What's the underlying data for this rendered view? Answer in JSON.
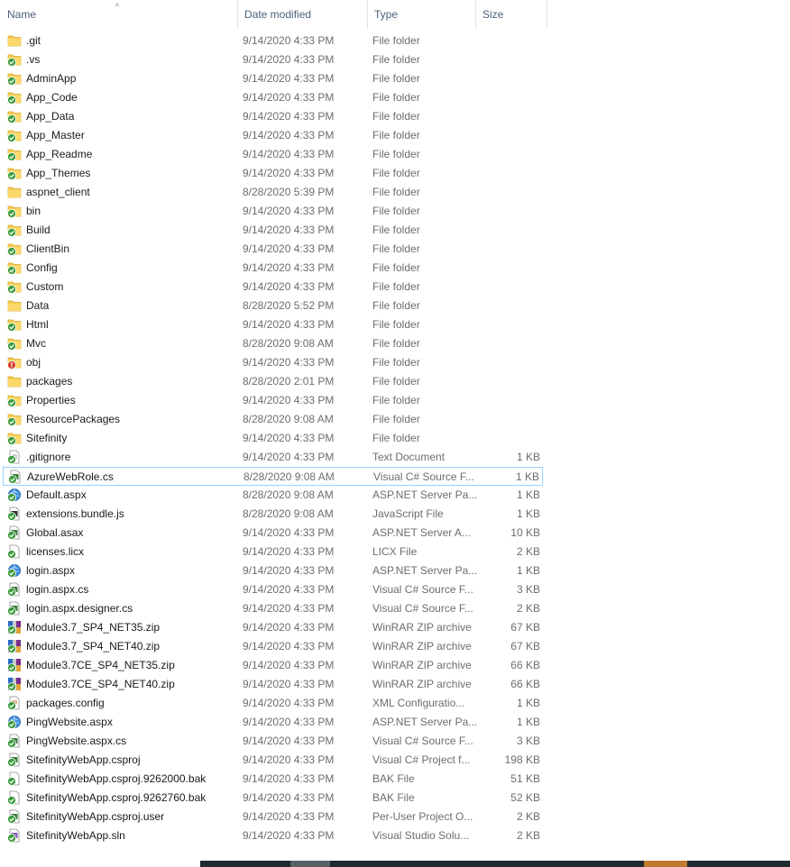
{
  "columns": {
    "name": "Name",
    "date": "Date modified",
    "type": "Type",
    "size": "Size"
  },
  "sort_arrow": "^",
  "colors": {
    "folder": "#f4c84f",
    "sync_ok": "#3a9a3a",
    "sync_error": "#d63b2e",
    "focus_border": "#99d1ff",
    "header_text": "#4c607a"
  },
  "rows": [
    {
      "name": ".git",
      "date": "9/14/2020 4:33 PM",
      "type": "File folder",
      "size": "",
      "icon": "folder",
      "badge": "none"
    },
    {
      "name": ".vs",
      "date": "9/14/2020 4:33 PM",
      "type": "File folder",
      "size": "",
      "icon": "folder",
      "badge": "ok"
    },
    {
      "name": "AdminApp",
      "date": "9/14/2020 4:33 PM",
      "type": "File folder",
      "size": "",
      "icon": "folder",
      "badge": "ok"
    },
    {
      "name": "App_Code",
      "date": "9/14/2020 4:33 PM",
      "type": "File folder",
      "size": "",
      "icon": "folder",
      "badge": "ok"
    },
    {
      "name": "App_Data",
      "date": "9/14/2020 4:33 PM",
      "type": "File folder",
      "size": "",
      "icon": "folder",
      "badge": "ok"
    },
    {
      "name": "App_Master",
      "date": "9/14/2020 4:33 PM",
      "type": "File folder",
      "size": "",
      "icon": "folder",
      "badge": "ok"
    },
    {
      "name": "App_Readme",
      "date": "9/14/2020 4:33 PM",
      "type": "File folder",
      "size": "",
      "icon": "folder",
      "badge": "ok"
    },
    {
      "name": "App_Themes",
      "date": "9/14/2020 4:33 PM",
      "type": "File folder",
      "size": "",
      "icon": "folder",
      "badge": "ok"
    },
    {
      "name": "aspnet_client",
      "date": "8/28/2020 5:39 PM",
      "type": "File folder",
      "size": "",
      "icon": "folder",
      "badge": "none"
    },
    {
      "name": "bin",
      "date": "9/14/2020 4:33 PM",
      "type": "File folder",
      "size": "",
      "icon": "folder",
      "badge": "ok"
    },
    {
      "name": "Build",
      "date": "9/14/2020 4:33 PM",
      "type": "File folder",
      "size": "",
      "icon": "folder",
      "badge": "ok"
    },
    {
      "name": "ClientBin",
      "date": "9/14/2020 4:33 PM",
      "type": "File folder",
      "size": "",
      "icon": "folder",
      "badge": "ok"
    },
    {
      "name": "Config",
      "date": "9/14/2020 4:33 PM",
      "type": "File folder",
      "size": "",
      "icon": "folder",
      "badge": "ok"
    },
    {
      "name": "Custom",
      "date": "9/14/2020 4:33 PM",
      "type": "File folder",
      "size": "",
      "icon": "folder",
      "badge": "ok"
    },
    {
      "name": "Data",
      "date": "8/28/2020 5:52 PM",
      "type": "File folder",
      "size": "",
      "icon": "folder",
      "badge": "none"
    },
    {
      "name": "Html",
      "date": "9/14/2020 4:33 PM",
      "type": "File folder",
      "size": "",
      "icon": "folder",
      "badge": "ok"
    },
    {
      "name": "Mvc",
      "date": "8/28/2020 9:08 AM",
      "type": "File folder",
      "size": "",
      "icon": "folder",
      "badge": "ok"
    },
    {
      "name": "obj",
      "date": "9/14/2020 4:33 PM",
      "type": "File folder",
      "size": "",
      "icon": "folder",
      "badge": "error"
    },
    {
      "name": "packages",
      "date": "8/28/2020 2:01 PM",
      "type": "File folder",
      "size": "",
      "icon": "folder",
      "badge": "none"
    },
    {
      "name": "Properties",
      "date": "9/14/2020 4:33 PM",
      "type": "File folder",
      "size": "",
      "icon": "folder",
      "badge": "ok"
    },
    {
      "name": "ResourcePackages",
      "date": "8/28/2020 9:08 AM",
      "type": "File folder",
      "size": "",
      "icon": "folder",
      "badge": "ok"
    },
    {
      "name": "Sitefinity",
      "date": "9/14/2020 4:33 PM",
      "type": "File folder",
      "size": "",
      "icon": "folder",
      "badge": "ok"
    },
    {
      "name": ".gitignore",
      "date": "9/14/2020 4:33 PM",
      "type": "Text Document",
      "size": "1 KB",
      "icon": "text",
      "badge": "ok"
    },
    {
      "name": "AzureWebRole.cs",
      "date": "8/28/2020 9:08 AM",
      "type": "Visual C# Source F...",
      "size": "1 KB",
      "icon": "code",
      "badge": "ok",
      "focused": true
    },
    {
      "name": "Default.aspx",
      "date": "8/28/2020 9:08 AM",
      "type": "ASP.NET Server Pa...",
      "size": "1 KB",
      "icon": "web",
      "badge": "ok"
    },
    {
      "name": "extensions.bundle.js",
      "date": "8/28/2020 9:08 AM",
      "type": "JavaScript File",
      "size": "1 KB",
      "icon": "script",
      "badge": "ok"
    },
    {
      "name": "Global.asax",
      "date": "9/14/2020 4:33 PM",
      "type": "ASP.NET Server A...",
      "size": "10 KB",
      "icon": "app",
      "badge": "ok"
    },
    {
      "name": "licenses.licx",
      "date": "9/14/2020 4:33 PM",
      "type": "LICX File",
      "size": "2 KB",
      "icon": "blank",
      "badge": "ok"
    },
    {
      "name": "login.aspx",
      "date": "9/14/2020 4:33 PM",
      "type": "ASP.NET Server Pa...",
      "size": "1 KB",
      "icon": "web",
      "badge": "ok"
    },
    {
      "name": "login.aspx.cs",
      "date": "9/14/2020 4:33 PM",
      "type": "Visual C# Source F...",
      "size": "3 KB",
      "icon": "code",
      "badge": "ok"
    },
    {
      "name": "login.aspx.designer.cs",
      "date": "9/14/2020 4:33 PM",
      "type": "Visual C# Source F...",
      "size": "2 KB",
      "icon": "code",
      "badge": "ok"
    },
    {
      "name": "Module3.7_SP4_NET35.zip",
      "date": "9/14/2020 4:33 PM",
      "type": "WinRAR ZIP archive",
      "size": "67 KB",
      "icon": "zip",
      "badge": "ok"
    },
    {
      "name": "Module3.7_SP4_NET40.zip",
      "date": "9/14/2020 4:33 PM",
      "type": "WinRAR ZIP archive",
      "size": "67 KB",
      "icon": "zip",
      "badge": "ok"
    },
    {
      "name": "Module3.7CE_SP4_NET35.zip",
      "date": "9/14/2020 4:33 PM",
      "type": "WinRAR ZIP archive",
      "size": "66 KB",
      "icon": "zip",
      "badge": "ok"
    },
    {
      "name": "Module3.7CE_SP4_NET40.zip",
      "date": "9/14/2020 4:33 PM",
      "type": "WinRAR ZIP archive",
      "size": "66 KB",
      "icon": "zip",
      "badge": "ok"
    },
    {
      "name": "packages.config",
      "date": "9/14/2020 4:33 PM",
      "type": "XML Configuratio...",
      "size": "1 KB",
      "icon": "config",
      "badge": "ok"
    },
    {
      "name": "PingWebsite.aspx",
      "date": "9/14/2020 4:33 PM",
      "type": "ASP.NET Server Pa...",
      "size": "1 KB",
      "icon": "web",
      "badge": "ok"
    },
    {
      "name": "PingWebsite.aspx.cs",
      "date": "9/14/2020 4:33 PM",
      "type": "Visual C# Source F...",
      "size": "3 KB",
      "icon": "code",
      "badge": "ok"
    },
    {
      "name": "SitefinityWebApp.csproj",
      "date": "9/14/2020 4:33 PM",
      "type": "Visual C# Project f...",
      "size": "198 KB",
      "icon": "project",
      "badge": "ok"
    },
    {
      "name": "SitefinityWebApp.csproj.9262000.bak",
      "date": "9/14/2020 4:33 PM",
      "type": "BAK File",
      "size": "51 KB",
      "icon": "blank",
      "badge": "ok"
    },
    {
      "name": "SitefinityWebApp.csproj.9262760.bak",
      "date": "9/14/2020 4:33 PM",
      "type": "BAK File",
      "size": "52 KB",
      "icon": "blank",
      "badge": "ok"
    },
    {
      "name": "SitefinityWebApp.csproj.user",
      "date": "9/14/2020 4:33 PM",
      "type": "Per-User Project O...",
      "size": "2 KB",
      "icon": "project",
      "badge": "ok"
    },
    {
      "name": "SitefinityWebApp.sln",
      "date": "9/14/2020 4:33 PM",
      "type": "Visual Studio Solu...",
      "size": "2 KB",
      "icon": "solution",
      "badge": "ok"
    }
  ]
}
